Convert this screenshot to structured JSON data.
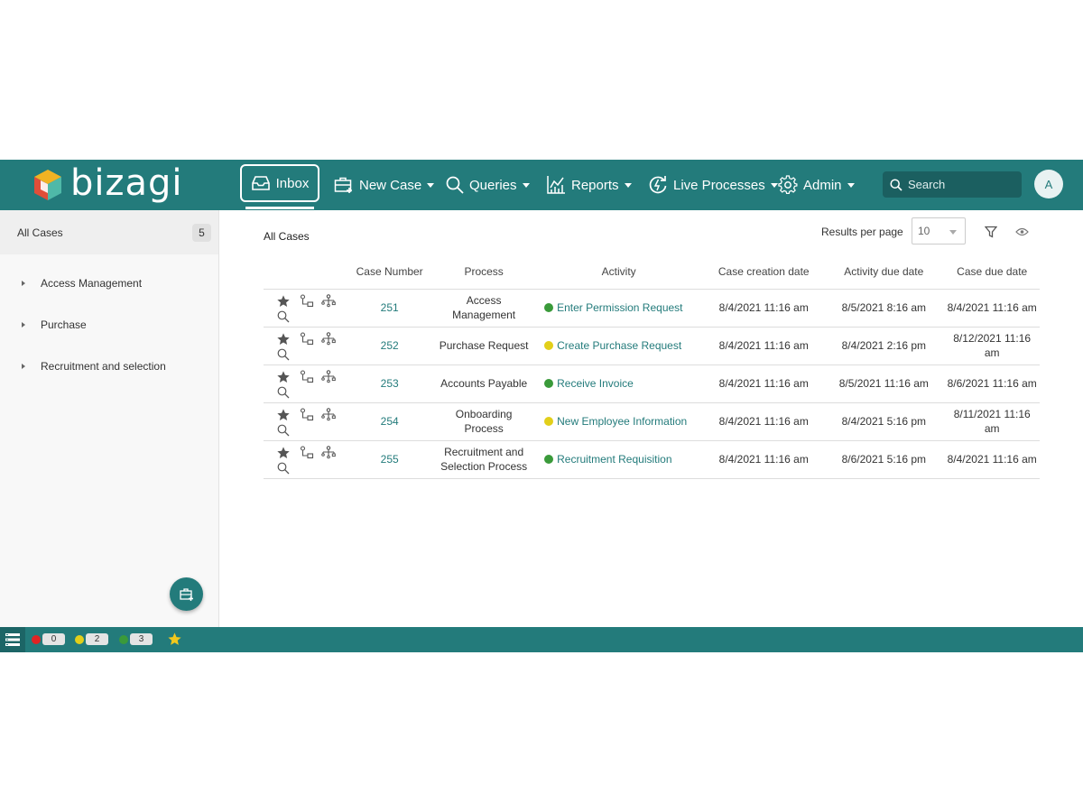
{
  "header": {
    "logo_text": "bizagi",
    "nav": {
      "inbox": "Inbox",
      "new_case": "New Case",
      "queries": "Queries",
      "reports": "Reports",
      "live_processes": "Live Processes",
      "admin": "Admin"
    },
    "search_placeholder": "Search",
    "avatar_initial": "A"
  },
  "sidebar": {
    "all_cases_label": "All Cases",
    "all_cases_count": "5",
    "items": [
      {
        "label": "Access Management"
      },
      {
        "label": "Purchase"
      },
      {
        "label": "Recruitment and selection"
      }
    ]
  },
  "main": {
    "title": "All Cases",
    "results_per_page_label": "Results per page",
    "results_per_page_value": "10",
    "columns": {
      "case_number": "Case Number",
      "process": "Process",
      "activity": "Activity",
      "creation": "Case creation date",
      "activity_due": "Activity due date",
      "case_due": "Case due date"
    },
    "rows": [
      {
        "case": "251",
        "process": "Access Management",
        "activity": "Enter Permission Request",
        "status": "green",
        "created": "8/4/2021 11:16 am",
        "activity_due": "8/5/2021 8:16 am",
        "case_due": "8/4/2021 11:16 am"
      },
      {
        "case": "252",
        "process": "Purchase Request",
        "activity": "Create Purchase Request",
        "status": "yellow",
        "created": "8/4/2021 11:16 am",
        "activity_due": "8/4/2021 2:16 pm",
        "case_due": "8/12/2021 11:16 am"
      },
      {
        "case": "253",
        "process": "Accounts Payable",
        "activity": "Receive Invoice",
        "status": "green",
        "created": "8/4/2021 11:16 am",
        "activity_due": "8/5/2021 11:16 am",
        "case_due": "8/6/2021 11:16 am"
      },
      {
        "case": "254",
        "process": "Onboarding Process",
        "activity": "New Employee Information",
        "status": "yellow",
        "created": "8/4/2021 11:16 am",
        "activity_due": "8/4/2021 5:16 pm",
        "case_due": "8/11/2021 11:16 am"
      },
      {
        "case": "255",
        "process": "Recruitment and Selection Process",
        "activity": "Recruitment Requisition",
        "status": "green",
        "created": "8/4/2021 11:16 am",
        "activity_due": "8/6/2021 5:16 pm",
        "case_due": "8/4/2021 11:16 am"
      }
    ]
  },
  "footer": {
    "overdue_count": "0",
    "at_risk_count": "2",
    "on_time_count": "3"
  },
  "colors": {
    "brand": "#237b7b",
    "green": "#3a9a3a",
    "yellow": "#e2cf1a",
    "red": "#e02424",
    "star": "#f2c81d"
  },
  "icons": {
    "row_icons": [
      "star-icon",
      "workflow-icon",
      "process-map-icon",
      "magnifier-icon"
    ],
    "nav_icons": [
      "inbox-icon",
      "new-case-icon",
      "search-icon",
      "reports-icon",
      "live-processes-icon",
      "gear-icon"
    ]
  }
}
